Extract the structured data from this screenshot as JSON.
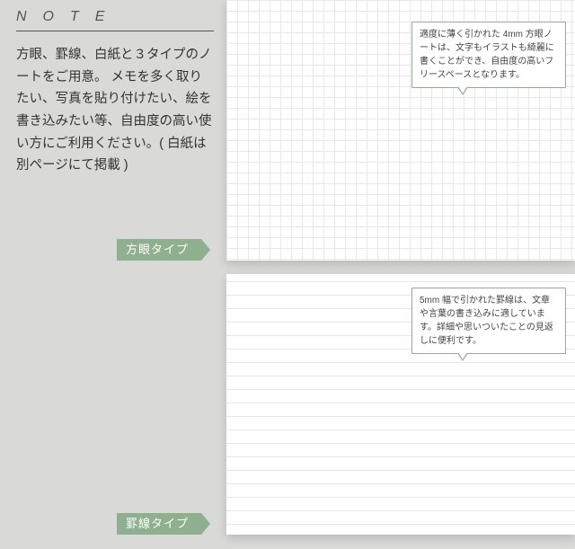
{
  "heading": "NOTE",
  "body": "方眼、罫線、白紙と３タイプのノートをご用意。\nメモを多く取りたい、写真を貼り付けたい、絵を書き込みたい等、自由度の高い使い方にご利用ください。( 白紙は別ページにて掲載 )",
  "grid": {
    "label": "方眼タイプ",
    "callout": "適度に薄く引かれた 4mm 方眼ノートは、文字もイラストも綺麗に書くことができ、自由度の高いフリースペースとなります。"
  },
  "ruled": {
    "label": "罫線タイプ",
    "callout": "5mm 幅で引かれた罫線は、文章や言葉の書き込みに適しています。詳細や思いついたことの見返しに便利です。"
  }
}
